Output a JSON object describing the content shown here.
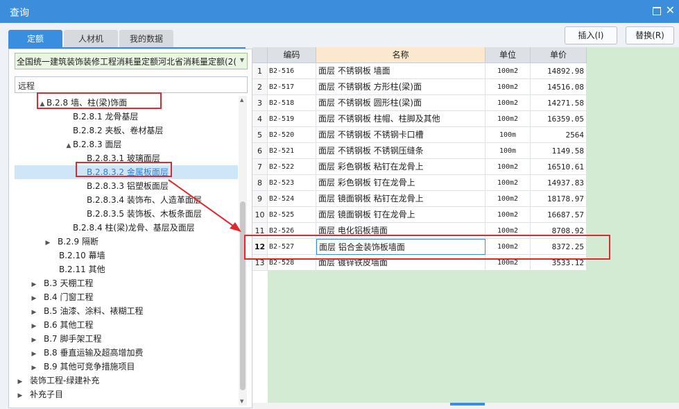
{
  "window": {
    "title": "查询",
    "max_icon": "maximize-icon",
    "close_icon": "close-icon"
  },
  "tabs": [
    {
      "label": "定额",
      "active": true
    },
    {
      "label": "人材机",
      "active": false
    },
    {
      "label": "我的数据",
      "active": false
    }
  ],
  "buttons": {
    "insert": "插入(I)",
    "replace": "替换(R)"
  },
  "library_select": {
    "value": "全国统一建筑装饰装修工程消耗量定额河北省消耗量定额(2("
  },
  "search": {
    "value": "远程"
  },
  "tree": [
    {
      "label": "B.2.8 墙、柱(梁)饰面",
      "toggle": "▲"
    },
    {
      "label": "B.2.8.1 龙骨基层",
      "toggle": ""
    },
    {
      "label": "B.2.8.2 夹板、卷材基层",
      "toggle": ""
    },
    {
      "label": "B.2.8.3 面层",
      "toggle": "▲"
    },
    {
      "label": "B.2.8.3.1 玻璃面层",
      "toggle": ""
    },
    {
      "label": "B.2.8.3.2 金属板面层",
      "toggle": "",
      "selected": true
    },
    {
      "label": "B.2.8.3.3 铝塑板面层",
      "toggle": ""
    },
    {
      "label": "B.2.8.3.4 装饰布、人造革面层",
      "toggle": ""
    },
    {
      "label": "B.2.8.3.5 装饰板、木板条面层",
      "toggle": ""
    },
    {
      "label": "B.2.8.4 柱(梁)龙骨、基层及面层",
      "toggle": ""
    },
    {
      "label": "B.2.9 隔断",
      "toggle": "▶"
    },
    {
      "label": "B.2.10 幕墙",
      "toggle": ""
    },
    {
      "label": "B.2.11 其他",
      "toggle": ""
    },
    {
      "label": "B.3 天棚工程",
      "toggle": "▶"
    },
    {
      "label": "B.4 门窗工程",
      "toggle": "▶"
    },
    {
      "label": "B.5 油漆、涂料、裱糊工程",
      "toggle": "▶"
    },
    {
      "label": "B.6 其他工程",
      "toggle": "▶"
    },
    {
      "label": "B.7 脚手架工程",
      "toggle": "▶"
    },
    {
      "label": "B.8 垂直运输及超高增加费",
      "toggle": "▶"
    },
    {
      "label": "B.9 其他可竞争措施项目",
      "toggle": "▶"
    },
    {
      "label": "装饰工程-绿建补充",
      "toggle": "▶"
    },
    {
      "label": "补充子目",
      "toggle": "▶"
    }
  ],
  "table": {
    "headers": [
      "编码",
      "名称",
      "单位",
      "单价"
    ],
    "rows": [
      {
        "idx": "1",
        "code": "B2-516",
        "name": "面层 不锈钢板 墙面",
        "unit": "100m2",
        "price": "14892.98"
      },
      {
        "idx": "2",
        "code": "B2-517",
        "name": "面层 不锈钢板 方形柱(梁)面",
        "unit": "100m2",
        "price": "14516.08"
      },
      {
        "idx": "3",
        "code": "B2-518",
        "name": "面层 不锈钢板 圆形柱(梁)面",
        "unit": "100m2",
        "price": "14271.58"
      },
      {
        "idx": "4",
        "code": "B2-519",
        "name": "面层 不锈钢板 柱帽、柱脚及其他",
        "unit": "100m2",
        "price": "16359.05"
      },
      {
        "idx": "5",
        "code": "B2-520",
        "name": "面层 不锈钢板 不锈钢卡口槽",
        "unit": "100m",
        "price": "2564"
      },
      {
        "idx": "6",
        "code": "B2-521",
        "name": "面层 不锈钢板 不锈钢压缝条",
        "unit": "100m",
        "price": "1149.58"
      },
      {
        "idx": "7",
        "code": "B2-522",
        "name": "面层 彩色钢板 粘钉在龙骨上",
        "unit": "100m2",
        "price": "16510.61"
      },
      {
        "idx": "8",
        "code": "B2-523",
        "name": "面层 彩色钢板 钉在龙骨上",
        "unit": "100m2",
        "price": "14937.83"
      },
      {
        "idx": "9",
        "code": "B2-524",
        "name": "面层 镜面钢板 粘钉在龙骨上",
        "unit": "100m2",
        "price": "18178.97"
      },
      {
        "idx": "10",
        "code": "B2-525",
        "name": "面层 镜面钢板 钉在龙骨上",
        "unit": "100m2",
        "price": "16687.57"
      },
      {
        "idx": "11",
        "code": "B2-526",
        "name": "面层 电化铝板墙面",
        "unit": "100m2",
        "price": "8708.92"
      },
      {
        "idx": "12",
        "code": "B2-527",
        "name": "面层 铝合金装饰板墙面",
        "unit": "100m2",
        "price": "8372.25",
        "active": true
      },
      {
        "idx": "13",
        "code": "B2-528",
        "name": "面层 镀锌铁皮墙面",
        "unit": "100m2",
        "price": "3533.12"
      }
    ]
  },
  "colors": {
    "title_bar": "#3c8ddb",
    "tab_active": "#3a8ee0",
    "grid_bg": "#d3ead3",
    "annotation": "#e0282e",
    "selected_row": "#cfe5f8"
  }
}
